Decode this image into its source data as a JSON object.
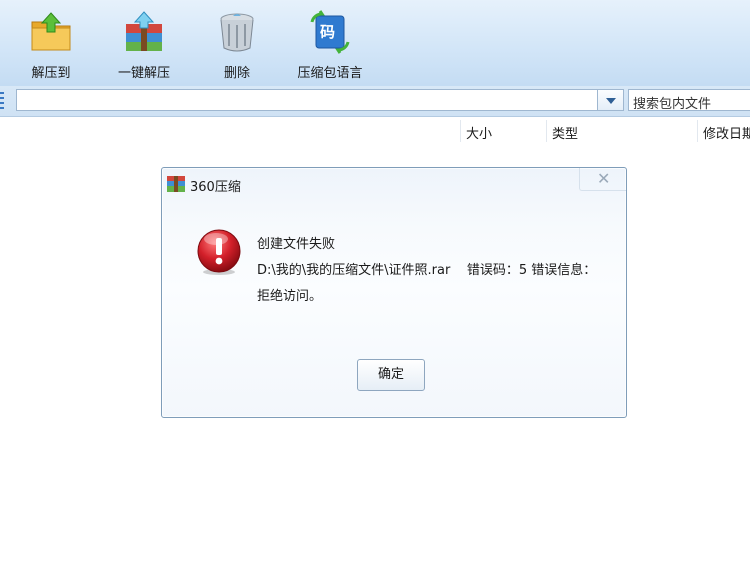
{
  "toolbar": {
    "extract_label": "解压到",
    "oneclick_label": "一键解压",
    "delete_label": "删除",
    "lang_label": "压缩包语言",
    "lang_icon_char": "码"
  },
  "address": {
    "path_value": "",
    "search_placeholder": "搜索包内文件"
  },
  "columns": {
    "size": "大小",
    "type": "类型",
    "modified": "修改日期"
  },
  "dialog": {
    "title": "360压缩",
    "close_glyph": "✕",
    "line1": "创建文件失败",
    "line2": "D:\\我的\\我的压缩文件\\证件照.rar    错误码：5 错误信息：",
    "line3": "拒绝访问。",
    "ok_label": "确定"
  },
  "colors": {
    "toolbar_bg": "#d3e6f8",
    "error_red": "#d3202a",
    "accent_blue": "#2f6fc0"
  },
  "icons": [
    "extract-folder-icon",
    "one-click-extract-icon",
    "delete-bin-icon",
    "language-code-icon",
    "app-logo-icon",
    "error-icon",
    "dropdown-arrow-icon",
    "close-icon"
  ]
}
